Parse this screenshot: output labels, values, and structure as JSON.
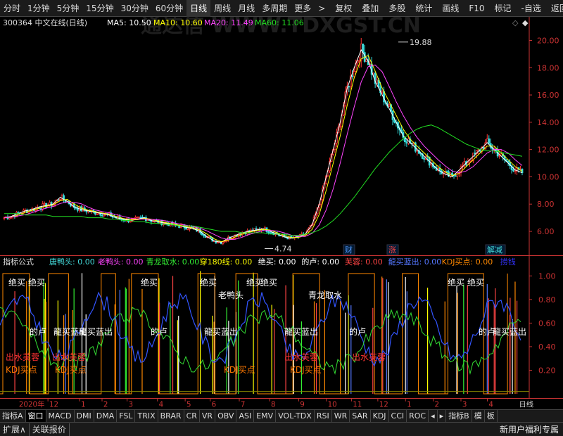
{
  "toolbar": {
    "periods": [
      "分时",
      "1分钟",
      "5分钟",
      "15分钟",
      "30分钟",
      "60分钟",
      "日线",
      "周线",
      "月线",
      "多周期",
      "更多"
    ],
    "active_period": "日线",
    "more_glyph": ">",
    "actions": [
      "复权",
      "叠加",
      "多股",
      "统计",
      "画线",
      "F10",
      "标记",
      "-自选",
      "返回"
    ]
  },
  "main": {
    "stock_title": "300364 中文在线(日线)",
    "ma": [
      {
        "label": "MA5: 10.50",
        "color": "#ffffff"
      },
      {
        "label": "MA10: 10.60",
        "color": "#ffff00"
      },
      {
        "label": "MA20: 11.49",
        "color": "#ff44ff"
      },
      {
        "label": "MA60: 11.06",
        "color": "#22dd22"
      }
    ],
    "watermark": "通达信 WWW.TDXGST.CN",
    "high_label": "19.88",
    "low_label": "4.74",
    "markers": [
      {
        "text": "财",
        "color": "#5599ff"
      },
      {
        "text": "涨",
        "color": "#ff4444"
      },
      {
        "text": "解减",
        "color": "#44dddd"
      }
    ],
    "icons": {
      "diamond": "◇",
      "settings": "◆"
    }
  },
  "chart_data": {
    "type": "candlestick",
    "yticks": [
      "20.00",
      "18.00",
      "16.00",
      "14.00",
      "12.00",
      "10.00",
      "8.00",
      "6.00"
    ],
    "ylim": [
      4.3,
      20.9
    ],
    "close_series": [
      7.0,
      7.1,
      7.3,
      7.5,
      7.6,
      7.8,
      7.9,
      8.0,
      8.5,
      8.2,
      7.8,
      7.6,
      7.5,
      7.4,
      7.3,
      7.2,
      7.0,
      6.9,
      6.8,
      6.9,
      7.0,
      6.8,
      6.7,
      6.6,
      6.5,
      6.4,
      6.3,
      6.2,
      6.0,
      5.6,
      5.3,
      5.2,
      5.5,
      5.7,
      5.9,
      6.0,
      6.1,
      6.2,
      6.0,
      5.8,
      5.6,
      5.5,
      5.6,
      5.8,
      6.5,
      8.0,
      10.0,
      12.0,
      14.0,
      16.5,
      18.0,
      19.3,
      18.5,
      17.0,
      16.0,
      15.0,
      14.0,
      13.0,
      12.5,
      12.0,
      11.5,
      11.0,
      10.5,
      10.2,
      10.0,
      10.5,
      11.0,
      11.5,
      12.0,
      12.5,
      12.0,
      11.5,
      11.0,
      10.5,
      10.3
    ],
    "ma60_series": [
      7.3,
      7.3,
      7.3,
      7.2,
      7.2,
      7.2,
      7.2,
      7.1,
      7.1,
      7.1,
      7.1,
      7.1,
      7.0,
      7.0,
      7.0,
      6.9,
      6.9,
      6.8,
      6.8,
      6.7,
      6.7,
      6.6,
      6.6,
      6.5,
      6.5,
      6.4,
      6.4,
      6.4,
      6.3,
      6.2,
      6.1,
      6.0,
      6.0,
      6.0,
      5.9,
      5.9,
      5.9,
      5.9,
      5.8,
      5.8,
      5.8,
      5.7,
      5.7,
      5.8,
      5.9,
      6.1,
      6.4,
      6.8,
      7.3,
      7.9,
      8.5,
      9.2,
      9.9,
      10.6,
      11.2,
      11.8,
      12.3,
      12.8,
      13.2,
      13.5,
      13.7,
      13.8,
      13.6,
      13.3,
      13.0,
      12.7,
      12.4,
      12.2,
      12.0,
      11.9,
      11.9,
      11.8,
      11.7,
      11.6,
      11.5
    ]
  },
  "indicator": {
    "title": "指标公式",
    "fields": [
      {
        "label": "唐鸭头: 0.00",
        "color": "#44dddd"
      },
      {
        "label": "老鸭头: 0.00",
        "color": "#ff44ff"
      },
      {
        "label": "青龙取水: 0.00",
        "color": "#33ee33"
      },
      {
        "label": "穿180线: 0.00",
        "color": "#ffff00"
      },
      {
        "label": "绝买: 0.00",
        "color": "#ffffff"
      },
      {
        "label": "的卢: 0.00",
        "color": "#ffffff"
      },
      {
        "label": "芙蓉: 0.00",
        "color": "#ff4444"
      },
      {
        "label": "龍买蓝出: 0.00",
        "color": "#5577ff"
      },
      {
        "label": "KDJ买点: 0.00",
        "color": "#ff8800"
      },
      {
        "label": "捞钱",
        "color": "#3333ff"
      }
    ],
    "yticks": [
      "1.00",
      "0.80",
      "0.60",
      "0.40",
      "0.20"
    ],
    "signals": [
      {
        "text": "绝买",
        "color": "#ffffff"
      },
      {
        "text": "绝买",
        "color": "#ffffff"
      },
      {
        "text": "绝买",
        "color": "#ffffff"
      },
      {
        "text": "绝买",
        "color": "#ffffff"
      },
      {
        "text": "绝买",
        "color": "#ffffff"
      },
      {
        "text": "绝买",
        "color": "#ffffff"
      },
      {
        "text": "绝买",
        "color": "#ffffff"
      },
      {
        "text": "绝买",
        "color": "#ffffff"
      },
      {
        "text": "老鸭头",
        "color": "#ffffff"
      },
      {
        "text": "青龙取水",
        "color": "#ffffff"
      },
      {
        "text": "的卢",
        "color": "#ffffff"
      },
      {
        "text": "的卢",
        "color": "#ffffff"
      },
      {
        "text": "的卢",
        "color": "#ffffff"
      },
      {
        "text": "的卢",
        "color": "#ffffff"
      },
      {
        "text": "龍买蓝出",
        "color": "#ffffff"
      },
      {
        "text": "龍买蓝出",
        "color": "#ffffff"
      },
      {
        "text": "龍买蓝出",
        "color": "#ffffff"
      },
      {
        "text": "龍买蓝出",
        "color": "#ffffff"
      },
      {
        "text": "龍买蓝出",
        "color": "#ffffff"
      },
      {
        "text": "出水芙蓉",
        "color": "#ff3333"
      },
      {
        "text": "出水芙蓉",
        "color": "#ff3333"
      },
      {
        "text": "出水芙蓉",
        "color": "#ff3333"
      },
      {
        "text": "出水芙蓉",
        "color": "#ff3333"
      },
      {
        "text": "KDJ买点",
        "color": "#ff7700"
      },
      {
        "text": "KDJ买点",
        "color": "#ff7700"
      },
      {
        "text": "KDJ买点",
        "color": "#ff7700"
      },
      {
        "text": "KDJ买点",
        "color": "#ff7700"
      }
    ]
  },
  "xaxis": {
    "year": "2020年",
    "months": [
      "12",
      "1",
      "2",
      "3",
      "4",
      "5",
      "6",
      "7",
      "8",
      "9",
      "10",
      "11",
      "12",
      "1",
      "2",
      "3",
      "4"
    ],
    "period": "日线"
  },
  "tabs": [
    "指标A",
    "窗口",
    "MACD",
    "DMI",
    "DMA",
    "FSL",
    "TRIX",
    "BRAR",
    "CR",
    "VR",
    "OBV",
    "ASI",
    "EMV",
    "VOL-TDX",
    "RSI",
    "WR",
    "SAR",
    "KDJ",
    "CCI",
    "ROC",
    "◂",
    "▸",
    "指标B",
    "模",
    "板"
  ],
  "active_tab": "窗口",
  "bottom": {
    "buttons": [
      "扩展∧",
      "关联报价"
    ],
    "note": "新用户福利专属"
  }
}
